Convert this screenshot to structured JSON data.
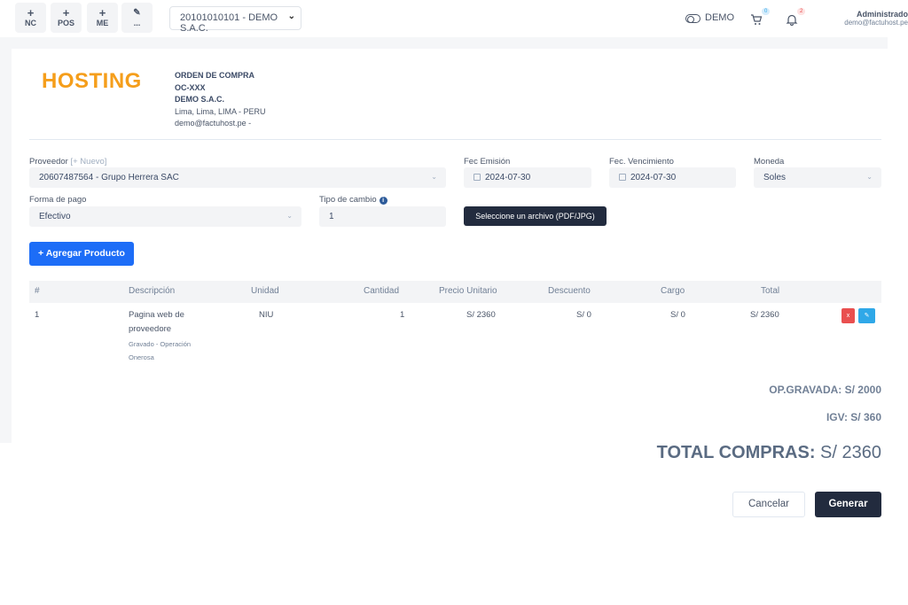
{
  "topbar": {
    "quick_buttons": [
      {
        "icon": "plus",
        "label": "NC"
      },
      {
        "icon": "plus",
        "label": "POS"
      },
      {
        "icon": "plus",
        "label": "ME"
      },
      {
        "icon": "pencil",
        "label": "..."
      }
    ],
    "company_select": "20101010101 - DEMO S.A.C.",
    "demo_label": "DEMO",
    "cart_badge": "0",
    "bell_badge": "2",
    "user_name": "Administrado",
    "user_email": "demo@factuhost.pe"
  },
  "header": {
    "logo_text": "HOSTING",
    "doc_type": "ORDEN DE COMPRA",
    "doc_number": "OC-XXX",
    "company": "DEMO S.A.C.",
    "location": "Lima, Lima, LIMA - PERU",
    "email": "demo@factuhost.pe -"
  },
  "form": {
    "proveedor_label": "Proveedor",
    "nuevo_link": "[+ Nuevo]",
    "proveedor_value": "20607487564 - Grupo Herrera SAC",
    "fec_emision_label": "Fec Emisión",
    "fec_emision_value": "2024-07-30",
    "fec_vencimiento_label": "Fec. Vencimiento",
    "fec_vencimiento_value": "2024-07-30",
    "moneda_label": "Moneda",
    "moneda_value": "Soles",
    "forma_pago_label": "Forma de pago",
    "forma_pago_value": "Efectivo",
    "tipo_cambio_label": "Tipo de cambio",
    "tipo_cambio_value": "1",
    "file_button": "Seleccione un archivo (PDF/JPG)",
    "add_product_button": "+ Agregar Producto"
  },
  "table": {
    "headers": [
      "#",
      "Descripción",
      "Unidad",
      "Cantidad",
      "Precio Unitario",
      "Descuento",
      "Cargo",
      "Total"
    ],
    "rows": [
      {
        "num": "1",
        "description": "Pagina web de proveedore",
        "affectation": "Gravado - Operación Onerosa",
        "unit": "NIU",
        "quantity": "1",
        "unit_price": "S/ 2360",
        "discount": "S/ 0",
        "charge": "S/ 0",
        "total": "S/ 2360",
        "delete_label": "x",
        "edit_label": "✎"
      }
    ]
  },
  "totals": {
    "op_gravada": "OP.GRAVADA: S/ 2000",
    "igv": "IGV: S/ 360",
    "total_label": "TOTAL COMPRAS:",
    "total_value": "S/ 2360"
  },
  "actions": {
    "cancel": "Cancelar",
    "submit": "Generar"
  },
  "colors": {
    "logo": "#f59e1b",
    "primary": "#1d6df7",
    "dark": "#222b3e",
    "danger": "#e94f4f",
    "info": "#2fa8e8"
  }
}
